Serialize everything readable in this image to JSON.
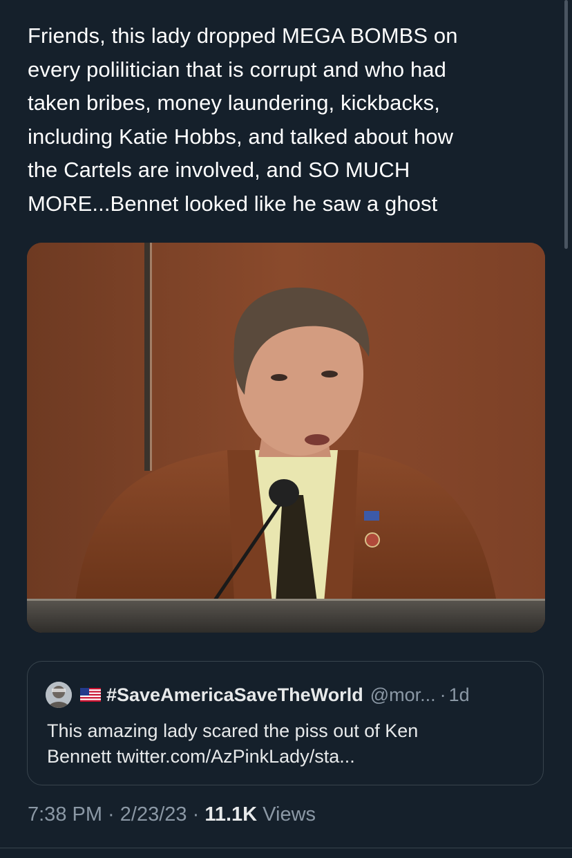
{
  "tweet": {
    "text_lines": [
      "Friends, this lady dropped MEGA BOMBS on",
      "every polilitician that is corrupt and who had",
      "taken bribes, money laundering, kickbacks,",
      "including Katie Hobbs, and talked about how",
      "the Cartels are involved, and SO MUCH",
      "MORE...Bennet looked like he saw a ghost"
    ]
  },
  "quoted_tweet": {
    "display_name": "#SaveAmericaSaveTheWorld",
    "handle": "@mor...",
    "separator": "·",
    "time": "1d",
    "flag_icon": "us-flag-emoji",
    "text_lines": [
      "This amazing lady scared the piss out of Ken",
      "Bennett twitter.com/AzPinkLady/sta..."
    ]
  },
  "meta": {
    "time": "7:38 PM",
    "dot1": " · ",
    "date": "2/23/23",
    "dot2": " · ",
    "views_count": "11.1K",
    "views_label": " Views"
  },
  "colors": {
    "background": "#15202b",
    "text_primary": "#e7e9ea",
    "text_secondary": "#8b98a5",
    "border": "#38444d"
  }
}
